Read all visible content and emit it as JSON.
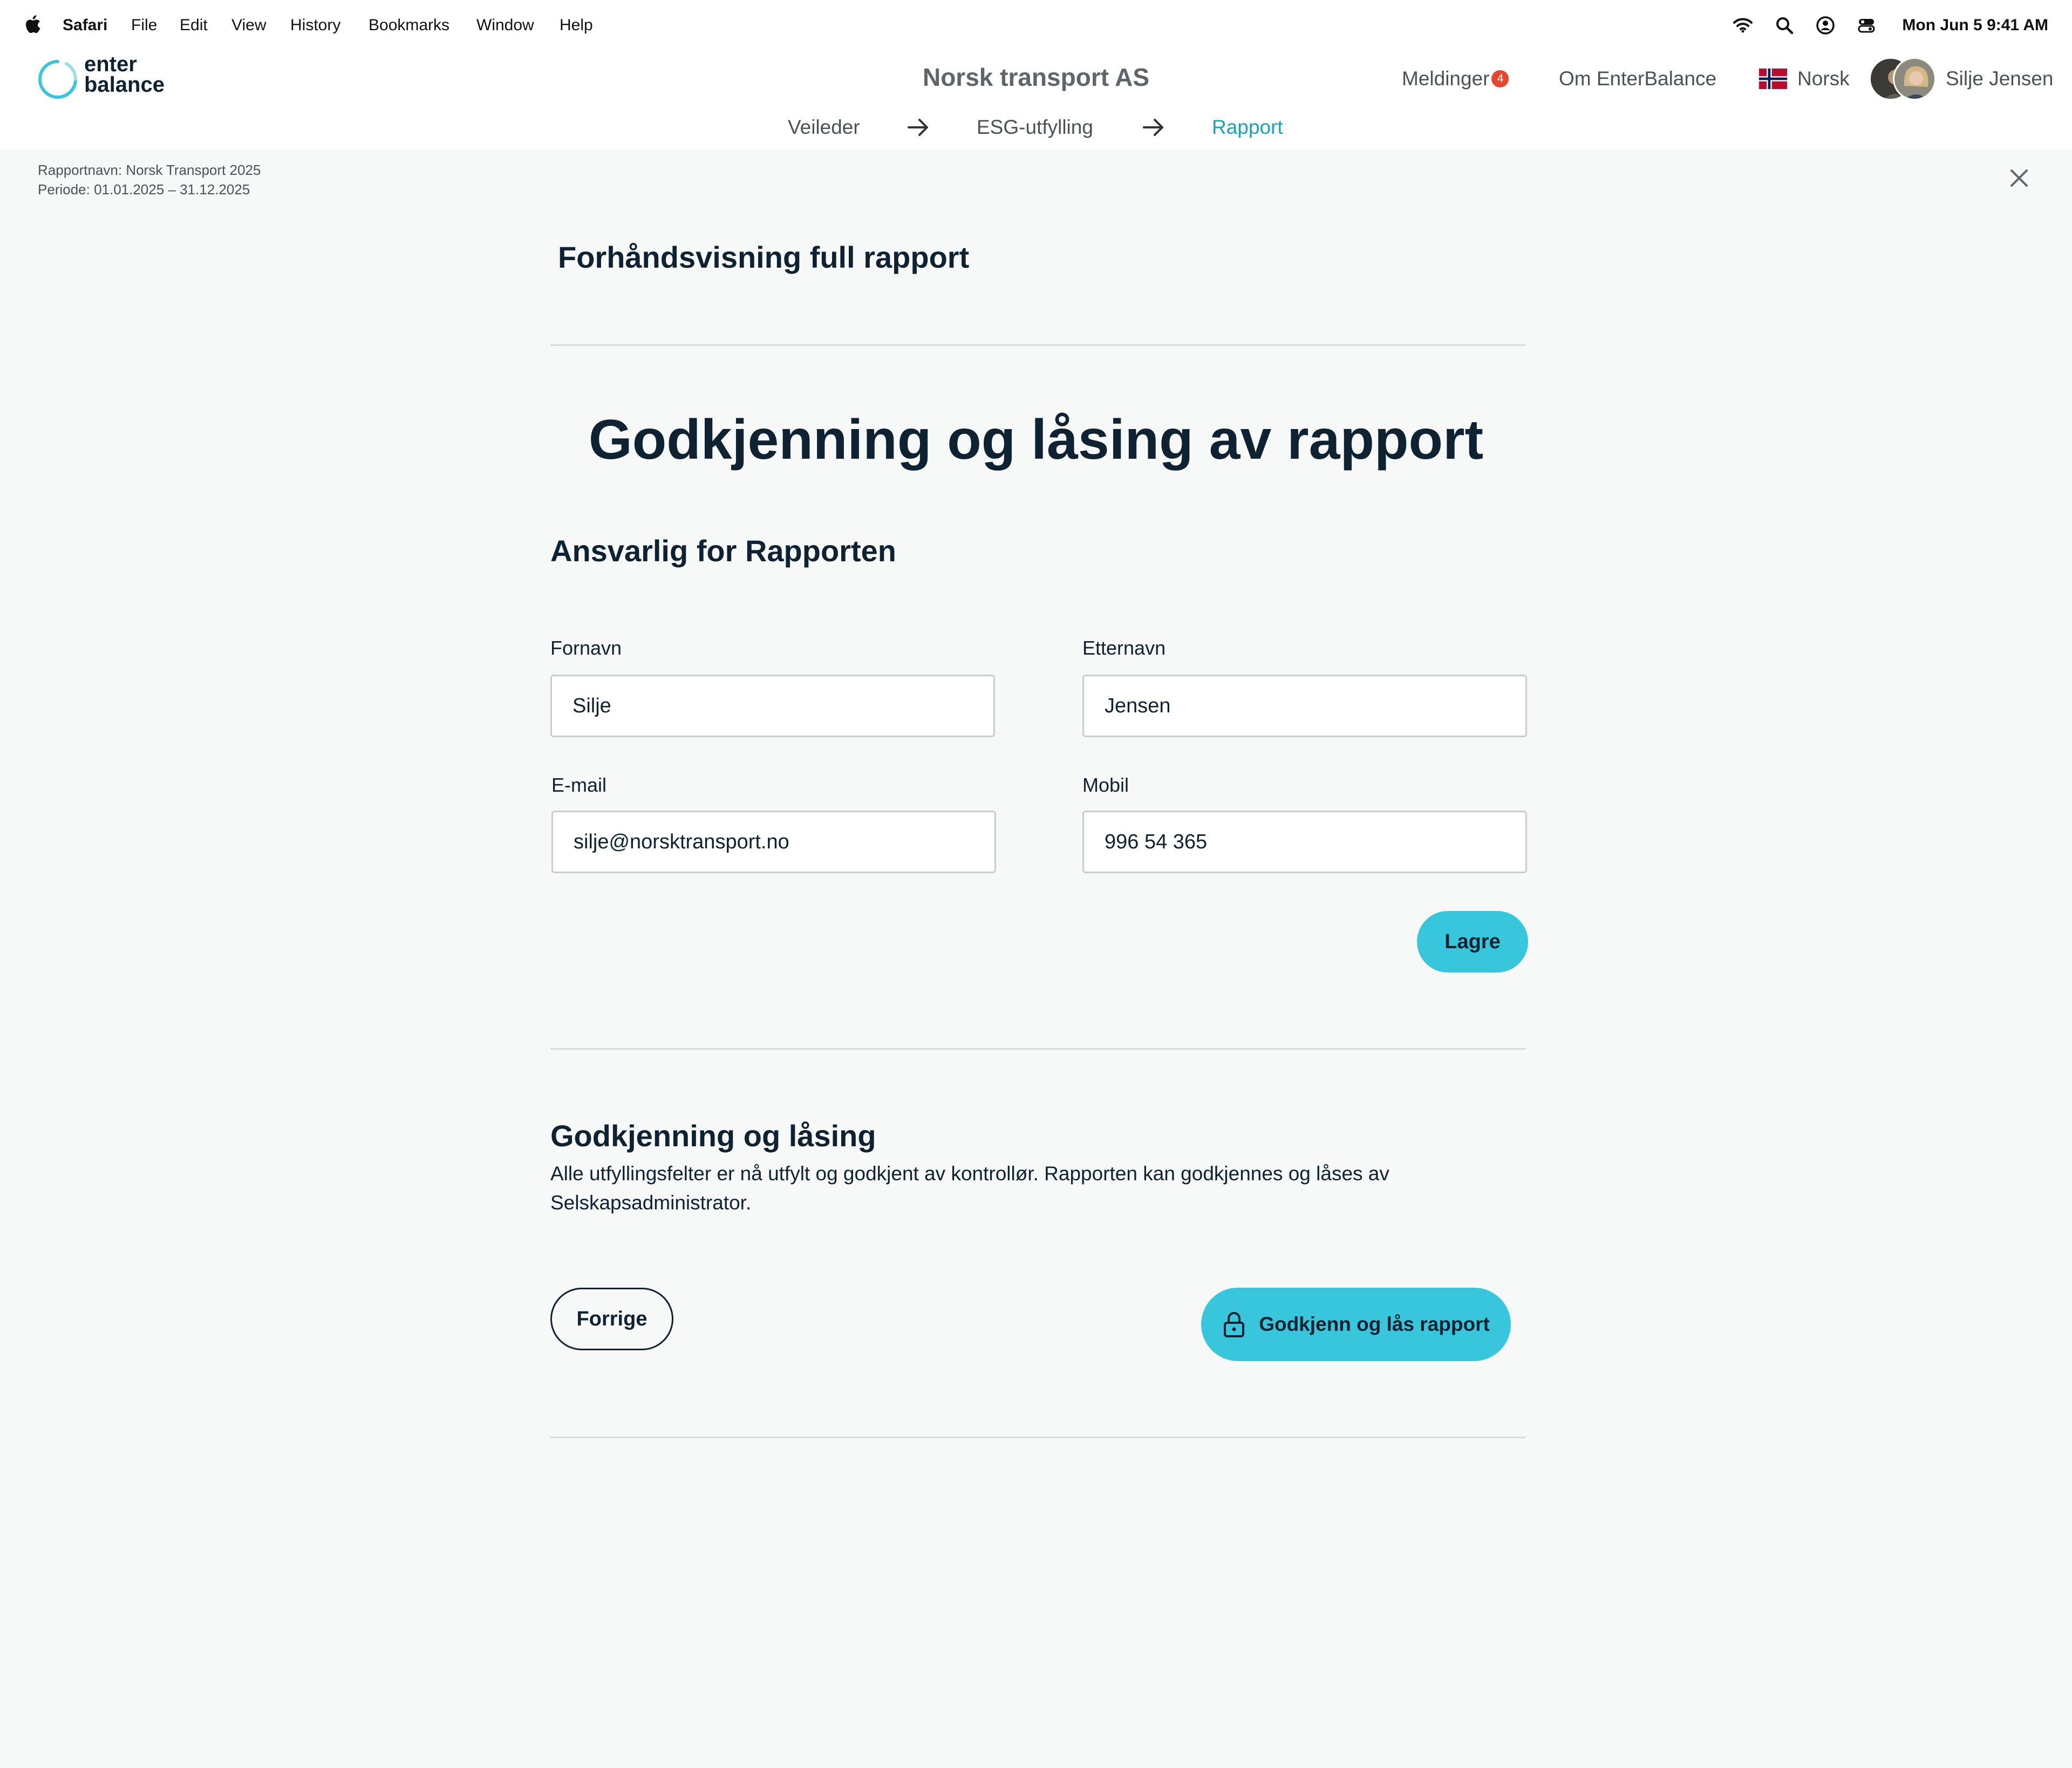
{
  "menubar": {
    "app": "Safari",
    "items": [
      "File",
      "Edit",
      "View",
      "History",
      "Bookmarks",
      "Window",
      "Help"
    ],
    "clock": "Mon Jun 5  9:41 AM",
    "icons": [
      "apple-logo-icon",
      "wifi-icon",
      "search-icon",
      "user-circle-icon",
      "control-center-icon"
    ]
  },
  "header": {
    "logo_line1": "enter",
    "logo_line2": "balance",
    "company": "Norsk transport AS",
    "messages_label": "Meldinger",
    "messages_count": "4",
    "about_label": "Om EnterBalance",
    "language_label": "Norsk",
    "user_name": "Silje Jensen",
    "steps": [
      "Veileder",
      "ESG-utfylling",
      "Rapport"
    ],
    "active_step": "Rapport",
    "colors": {
      "accent": "#38c6dc",
      "active_step": "#1aa3b8",
      "badge": "#e8452f"
    }
  },
  "report_meta": {
    "name": "Rapportnavn: Norsk Transport 2025",
    "period": "Periode: 01.01.2025 – 31.12.2025"
  },
  "content": {
    "preview_title": "Forhåndsvisning full rapport",
    "main_heading": "Godkjenning og låsing av rapport",
    "responsible_heading": "Ansvarlig for Rapporten",
    "fields": {
      "first_name_label": "Fornavn",
      "first_name_value": "Silje",
      "last_name_label": "Etternavn",
      "last_name_value": "Jensen",
      "email_label": "E-mail",
      "email_value": "silje@norsktransport.no",
      "mobile_label": "Mobil",
      "mobile_value": "996 54 365"
    },
    "save_label": "Lagre",
    "approval_heading": "Godkjenning og låsing",
    "approval_text": "Alle utfyllingsfelter er nå utfylt og godkjent av kontrollør. Rapporten kan godkjennes og låses av Selskapsadministrator.",
    "prev_label": "Forrige",
    "approve_label": "Godkjenn og lås rapport"
  }
}
